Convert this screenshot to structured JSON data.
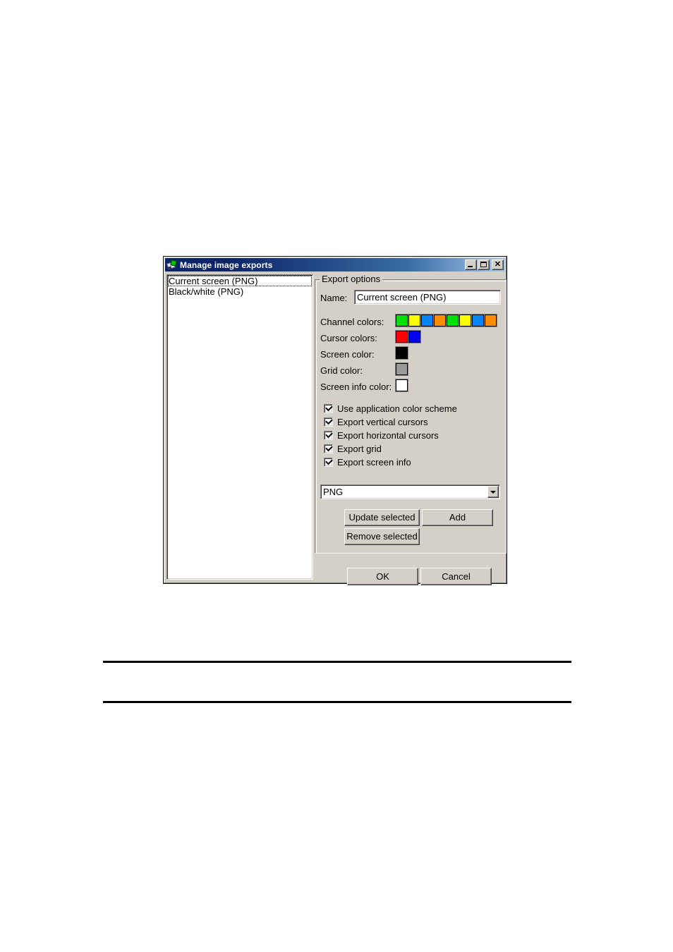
{
  "window": {
    "title": "Manage image exports",
    "icon": "image-export-icon",
    "controls": {
      "minimize": "minimize-button",
      "maximize": "maximize-button",
      "close": "close-button"
    }
  },
  "list": {
    "name": "export-list",
    "items": [
      {
        "label": "Current screen (PNG)",
        "focused": true
      },
      {
        "label": "Black/white (PNG)",
        "focused": false
      }
    ]
  },
  "group": {
    "title": "Export options"
  },
  "name_field": {
    "label": "Name:",
    "value": "Current screen (PNG)",
    "placeholder": ""
  },
  "color_rows": [
    {
      "label": "Channel colors:",
      "key": "channel-colors",
      "swatches": [
        "#00e000",
        "#ffff00",
        "#0a84f0",
        "#ff8c00",
        "#00e000",
        "#ffff00",
        "#0a84f0",
        "#ff8c00"
      ]
    },
    {
      "label": "Cursor colors:",
      "key": "cursor-colors",
      "swatches": [
        "#ff0000",
        "#0000ee"
      ]
    },
    {
      "label": "Screen color:",
      "key": "screen-color",
      "swatches": [
        "#000000"
      ]
    },
    {
      "label": "Grid color:",
      "key": "grid-color",
      "swatches": [
        "#999999"
      ]
    },
    {
      "label": "Screen info color:",
      "key": "screen-info-color",
      "swatches": [
        "#ffffff"
      ]
    }
  ],
  "checkboxes": [
    {
      "label": "Use application color scheme",
      "key": "use-application-color-scheme",
      "checked": true
    },
    {
      "label": "Export vertical cursors",
      "key": "export-vertical-cursors",
      "checked": true
    },
    {
      "label": "Export horizontal cursors",
      "key": "export-horizontal-cursors",
      "checked": true
    },
    {
      "label": "Export grid",
      "key": "export-grid",
      "checked": true
    },
    {
      "label": "Export screen info",
      "key": "export-screen-info",
      "checked": true
    }
  ],
  "format_combo": {
    "value": "PNG",
    "options": [
      "PNG"
    ]
  },
  "buttons": {
    "update_selected": "Update selected",
    "add": "Add",
    "remove_selected": "Remove selected",
    "ok": "OK",
    "cancel": "Cancel"
  },
  "theme": {
    "dialog_face": "#d4d0c8",
    "titlebar_start": "#0a246a",
    "titlebar_end": "#a6caf0",
    "title_text": "#ffffff",
    "text": "#000000",
    "field_bg": "#ffffff"
  }
}
